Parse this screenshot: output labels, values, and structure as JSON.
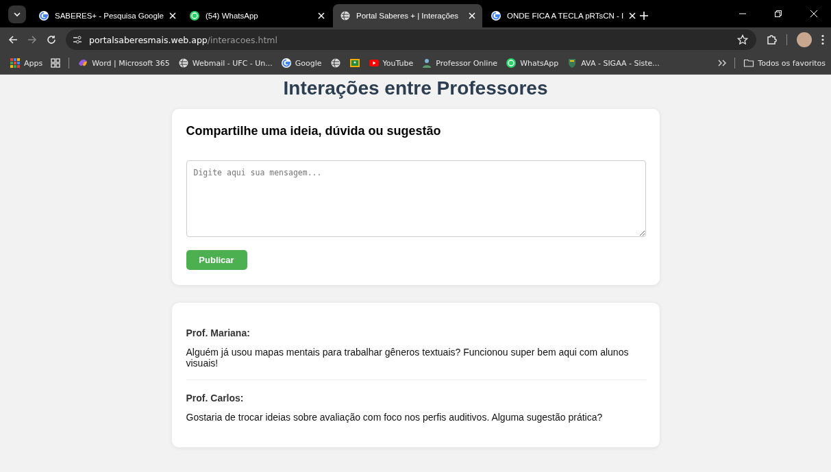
{
  "browser": {
    "tabs": [
      {
        "title": "SABERES+ - Pesquisa Google",
        "selected": false
      },
      {
        "title": "(54) WhatsApp",
        "selected": false
      },
      {
        "title": "Portal Saberes + | Interações",
        "selected": true
      },
      {
        "title": "ONDE FICA A TECLA pRTsCN - I",
        "selected": false
      }
    ],
    "address": {
      "host": "portalsaberesmais.web.app",
      "path": "/interacoes.html"
    },
    "bookmarks": [
      {
        "label": "Apps"
      },
      {
        "label": "Word | Microsoft 365"
      },
      {
        "label": "Webmail - UFC - Un..."
      },
      {
        "label": "Google"
      },
      {
        "label": "YouTube"
      },
      {
        "label": "Professor Online"
      },
      {
        "label": "WhatsApp"
      },
      {
        "label": "AVA - SIGAA - Siste..."
      }
    ],
    "all_bookmarks": "Todos os favoritos"
  },
  "page": {
    "title": "Interações entre Professores",
    "form": {
      "heading": "Compartilhe uma ideia, dúvida ou sugestão",
      "placeholder": "Digite aqui sua mensagem...",
      "button": "Publicar"
    },
    "posts": [
      {
        "author": "Prof. Mariana:",
        "text": "Alguém já usou mapas mentais para trabalhar gêneros textuais? Funcionou super bem aqui com alunos visuais!"
      },
      {
        "author": "Prof. Carlos:",
        "text": "Gostaria de trocar ideias sobre avaliação com foco nos perfis auditivos. Alguma sugestão prática?"
      }
    ]
  }
}
